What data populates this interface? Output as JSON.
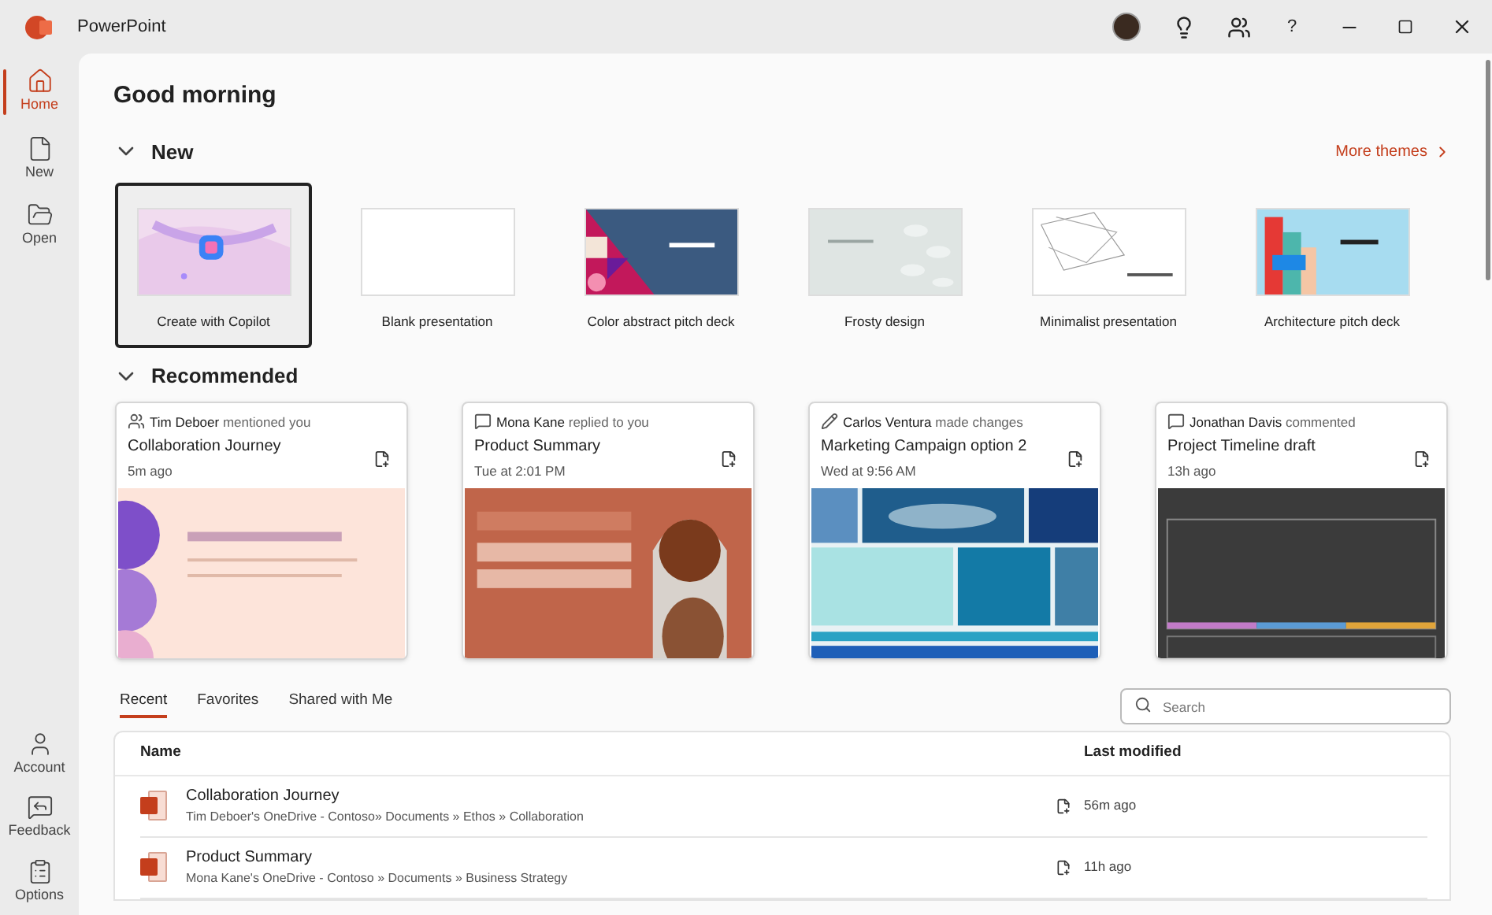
{
  "window": {
    "title": "PowerPoint",
    "help": "?"
  },
  "sidebar": {
    "top": [
      {
        "label": "Home",
        "selected": true
      },
      {
        "label": "New",
        "selected": false
      },
      {
        "label": "Open",
        "selected": false
      }
    ],
    "bottom": [
      {
        "label": "Account"
      },
      {
        "label": "Feedback"
      },
      {
        "label": "Options"
      }
    ]
  },
  "greeting": "Good morning",
  "new_section": {
    "title": "New",
    "expanded": true,
    "more_link": "More themes",
    "templates": [
      {
        "label": "Create with Copilot",
        "selected": true,
        "kind": "picture"
      },
      {
        "label": "Blank presentation",
        "selected": false,
        "kind": "blank"
      },
      {
        "label": "Color abstract pitch deck",
        "selected": false,
        "kind": "picture"
      },
      {
        "label": "Frosty design",
        "selected": false,
        "kind": "picture"
      },
      {
        "label": "Minimalist presentation",
        "selected": false,
        "kind": "picture"
      },
      {
        "label": "Architecture pitch deck",
        "selected": false,
        "kind": "picture"
      }
    ]
  },
  "recommended": {
    "title": "Recommended",
    "expanded": true,
    "cards": [
      {
        "kind": "mention",
        "person": "Tim Deboer",
        "action": "mentioned you",
        "title": "Collaboration Journey",
        "time": "5m ago"
      },
      {
        "kind": "reply",
        "person": "Mona Kane",
        "action": "replied to you",
        "title": "Product Summary",
        "time": "Tue at 2:01 PM"
      },
      {
        "kind": "edit",
        "person": "Carlos Ventura",
        "action": "made changes",
        "title": "Marketing Campaign option 2",
        "time": "Wed at 9:56 AM"
      },
      {
        "kind": "comment",
        "person": "Jonathan Davis",
        "action": "commented",
        "title": "Project Timeline draft",
        "time": "13h ago"
      }
    ]
  },
  "files": {
    "tabs": [
      {
        "label": "Recent",
        "selected": true
      },
      {
        "label": "Favorites",
        "selected": false
      },
      {
        "label": "Shared with Me",
        "selected": false
      }
    ],
    "search": {
      "placeholder": "Search"
    },
    "columns": [
      "Name",
      "Last modified"
    ],
    "rows": [
      {
        "name": "Collaboration Journey",
        "path": "Tim Deboer's OneDrive - Contoso» Documents » Ethos » Collaboration",
        "modified": "56m ago"
      },
      {
        "name": "Product Summary",
        "path": "Mona Kane's OneDrive - Contoso » Documents » Business Strategy",
        "modified": "11h ago"
      }
    ]
  }
}
